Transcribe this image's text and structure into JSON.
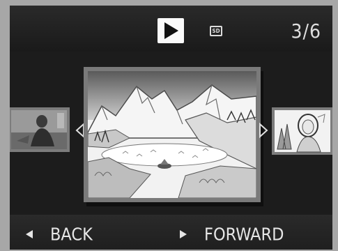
{
  "topbar": {
    "mode_icon": "play-icon",
    "media_icon": "sd-card-icon",
    "media_label": "SD",
    "counter": "3/6"
  },
  "thumbnails": {
    "previous": "portrait-photo",
    "current": "mountain-landscape-illustration",
    "next": "woman-illustration"
  },
  "bottombar": {
    "back_label": "BACK",
    "forward_label": "FORWARD"
  },
  "colors": {
    "screen_bg": "#1c1c1c",
    "bezel": "#a7a7a7",
    "text": "#e6e6e6"
  }
}
